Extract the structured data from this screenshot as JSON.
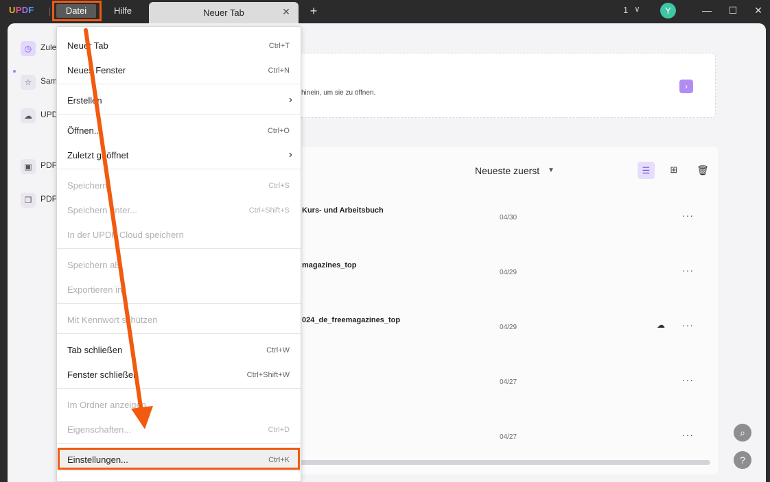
{
  "app": {
    "logo": {
      "u": "U",
      "p": "P",
      "d": "D",
      "f": "F"
    },
    "menubar": {
      "datei": "Datei",
      "hilfe": "Hilfe"
    },
    "tab": {
      "label": "Neuer Tab"
    },
    "window_count": "1",
    "avatar_letter": "Y"
  },
  "sidebar": {
    "items": [
      {
        "label": "Zule",
        "icon": "clock-icon"
      },
      {
        "label": "Sam",
        "icon": "star-icon"
      },
      {
        "label": "UPD",
        "icon": "cloud-icon"
      },
      {
        "label": "PDF",
        "icon": "briefcase-icon"
      },
      {
        "label": "PDF",
        "icon": "layers-icon"
      }
    ]
  },
  "drop_zone": {
    "hint": "hinein, um sie zu öffnen."
  },
  "list": {
    "sort_label": "Neueste zuerst",
    "rows": [
      {
        "name": "Kurs- und Arbeitsbuch",
        "date": "04/30"
      },
      {
        "name": "magazines_top",
        "date": "04/29"
      },
      {
        "name": "024_de_freemagazines_top",
        "date": "04/29"
      },
      {
        "name": "",
        "date": "04/27"
      },
      {
        "name": "",
        "date": "04/27"
      }
    ]
  },
  "menu": {
    "items": [
      {
        "label": "Neuer Tab",
        "shortcut": "Ctrl+T"
      },
      {
        "label": "Neues Fenster",
        "shortcut": "Ctrl+N"
      },
      {
        "label": "Erstellen",
        "shortcut": ""
      },
      {
        "label": "Öffnen...",
        "shortcut": "Ctrl+O"
      },
      {
        "label": "Zuletzt geöffnet",
        "shortcut": ""
      },
      {
        "label": "Speichern",
        "shortcut": "Ctrl+S"
      },
      {
        "label": "Speichern unter...",
        "shortcut": "Ctrl+Shift+S"
      },
      {
        "label": "In der UPDF Cloud speichern",
        "shortcut": ""
      },
      {
        "label": "Speichern als",
        "shortcut": ""
      },
      {
        "label": "Exportieren in",
        "shortcut": ""
      },
      {
        "label": "Mit Kennwort schützen",
        "shortcut": ""
      },
      {
        "label": "Tab schließen",
        "shortcut": "Ctrl+W"
      },
      {
        "label": "Fenster schließen",
        "shortcut": "Ctrl+Shift+W"
      },
      {
        "label": "Im Ordner anzeigen",
        "shortcut": ""
      },
      {
        "label": "Eigenschaften...",
        "shortcut": "Ctrl+D"
      },
      {
        "label": "Einstellungen...",
        "shortcut": "Ctrl+K"
      }
    ]
  },
  "annotation_color": "#f15a0f",
  "accent_color": "#b18cf5"
}
